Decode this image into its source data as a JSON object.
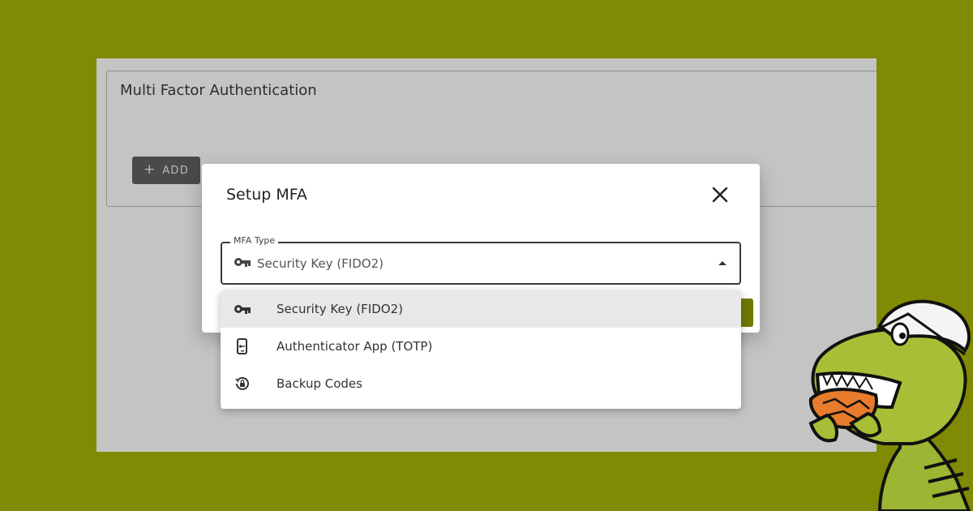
{
  "background_color": "#808a03",
  "accent_color": "#6f7a05",
  "card": {
    "title": "Multi Factor Authentication",
    "add_button": {
      "icon": "plus-icon",
      "label": "ADD"
    }
  },
  "dialog": {
    "title": "Setup MFA",
    "close_icon": "close-icon"
  },
  "mfa_select": {
    "label": "MFA Type",
    "value": "Security Key (FIDO2)",
    "value_icon": "key-icon",
    "expanded": true
  },
  "menu": {
    "items": [
      {
        "label": "Security Key (FIDO2)",
        "icon": "key-icon",
        "selected": true
      },
      {
        "label": "Authenticator App (TOTP)",
        "icon": "phone-key-icon",
        "selected": false
      },
      {
        "label": "Backup Codes",
        "icon": "lock-reset-icon",
        "selected": false
      }
    ]
  }
}
